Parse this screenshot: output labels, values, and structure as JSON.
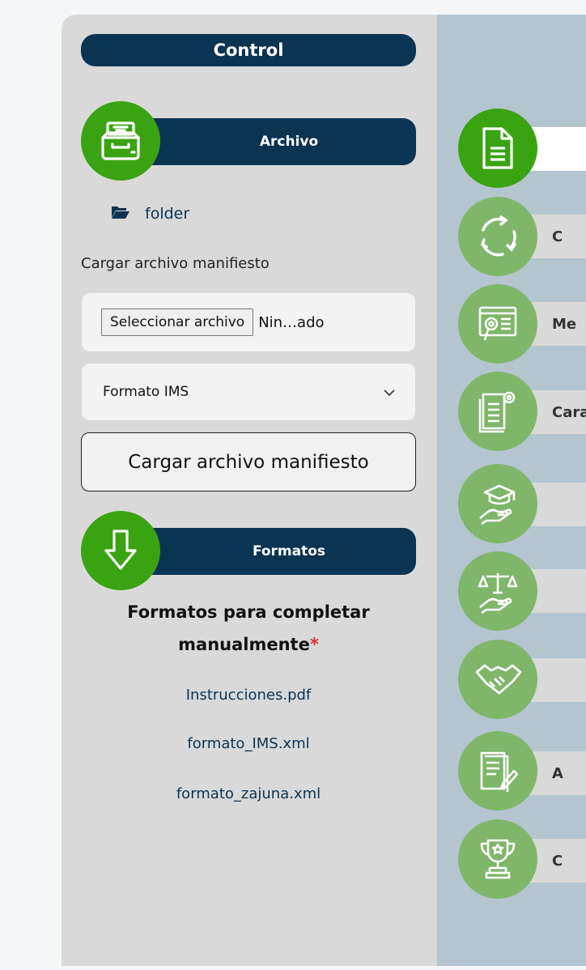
{
  "control": {
    "title": "Control"
  },
  "archivo": {
    "header": "Archivo",
    "folder_label": "folder",
    "upload_label": "Cargar archivo manifiesto",
    "file_button": "Seleccionar archivo",
    "file_status": "Nin…ado",
    "format_select": {
      "selected": "Formato IMS"
    },
    "load_button": "Cargar archivo manifiesto"
  },
  "formatos": {
    "header": "Formatos",
    "title_line1": "Formatos para completar",
    "title_line2": "manualmente",
    "required_mark": "*",
    "files": [
      "Instrucciones.pdf",
      "formato_IMS.xml",
      "formato_zajuna.xml"
    ]
  },
  "steps": [
    {
      "icon": "document-icon",
      "label": ""
    },
    {
      "icon": "cycle-icon",
      "label": "C"
    },
    {
      "icon": "metadata-icon",
      "label": "Me"
    },
    {
      "icon": "characteristics-icon",
      "label": "Cara"
    },
    {
      "icon": "education-hand-icon",
      "label": ""
    },
    {
      "icon": "legal-balance-icon",
      "label": ""
    },
    {
      "icon": "handshake-icon",
      "label": ""
    },
    {
      "icon": "edit-document-icon",
      "label": "A"
    },
    {
      "icon": "trophy-icon",
      "label": "C"
    }
  ],
  "colors": {
    "navy": "#0b3352",
    "green_active": "#3aa312",
    "green_inactive": "#7fb66a",
    "panel_gray": "#d9d9d9",
    "right_panel": "#b4c5cf"
  }
}
